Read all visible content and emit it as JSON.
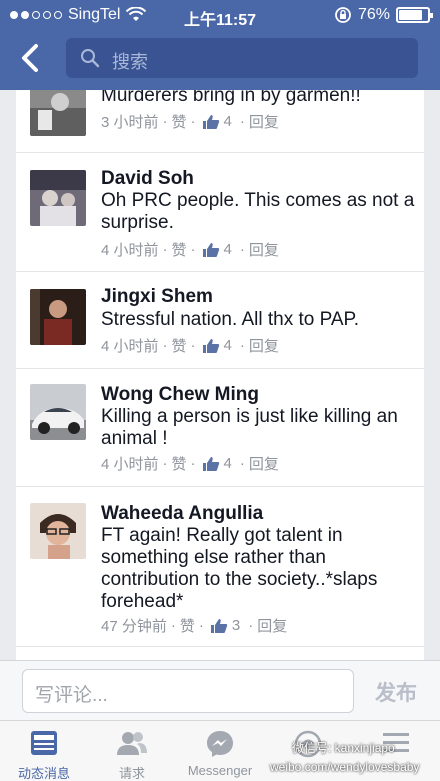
{
  "status_bar": {
    "carrier": "SingTel",
    "time": "上午11:57",
    "battery": "76%"
  },
  "nav": {
    "search_placeholder": "搜索"
  },
  "comments": [
    {
      "name": "",
      "text": "Murderers bring in by garmen!!",
      "time": "3 小时前",
      "like": "赞",
      "likes": "4",
      "reply": "回复"
    },
    {
      "name": "David Soh",
      "text": "Oh PRC people. This comes as not a surprise.",
      "time": "4 小时前",
      "like": "赞",
      "likes": "4",
      "reply": "回复"
    },
    {
      "name": "Jingxi Shem",
      "text": "Stressful nation. All thx to PAP.",
      "time": "4 小时前",
      "like": "赞",
      "likes": "4",
      "reply": "回复"
    },
    {
      "name": "Wong Chew Ming",
      "text": "Killing a person is just like killing an animal !",
      "time": "4 小时前",
      "like": "赞",
      "likes": "4",
      "reply": "回复"
    },
    {
      "name": "Waheeda Angullia",
      "text": "FT again! Really got talent in something else rather than contribution to the society..*slaps forehead*",
      "time": "47 分钟前",
      "like": "赞",
      "likes": "3",
      "reply": "回复"
    }
  ],
  "composer": {
    "placeholder": "写评论...",
    "post_label": "发布"
  },
  "tabs": [
    {
      "label": "动态消息",
      "icon": "news-feed-icon"
    },
    {
      "label": "请求",
      "icon": "friend-requests-icon"
    },
    {
      "label": "Messenger",
      "icon": "messenger-icon"
    },
    {
      "label": "",
      "icon": "notifications-icon"
    },
    {
      "label": "",
      "icon": "more-menu-icon"
    }
  ],
  "watermark": {
    "line1": "微信号: kanxinjiapo",
    "line2": "weibo.com/wendylovesbaby"
  },
  "colors": {
    "header": "#4a67a8",
    "meta": "#90949c"
  }
}
